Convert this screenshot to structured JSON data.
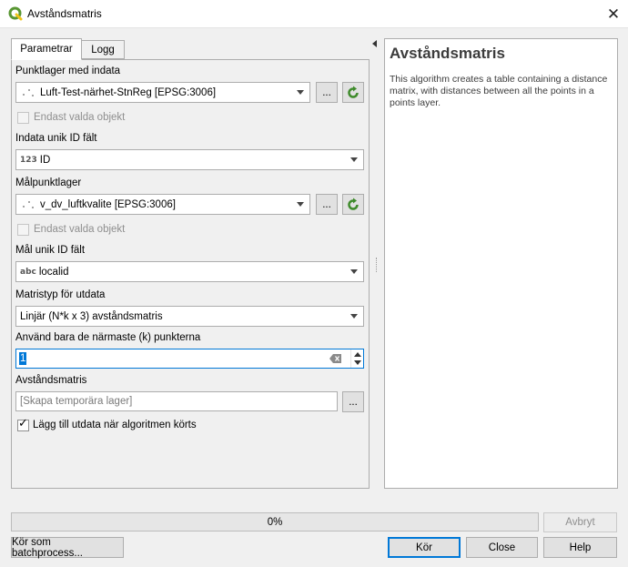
{
  "window": {
    "title": "Avståndsmatris",
    "close_symbol": "✕"
  },
  "tabs": {
    "parameters": "Parametrar",
    "log": "Logg"
  },
  "form": {
    "input_layer": {
      "label": "Punktlager med indata",
      "value": "Luft-Test-närhet-StnReg [EPSG:3006]",
      "iter_label": "...",
      "selected_only": "Endast valda objekt"
    },
    "input_id": {
      "label": "Indata unik ID fält",
      "type_tag": "123",
      "value": "ID"
    },
    "target_layer": {
      "label": "Målpunktlager",
      "value": "v_dv_luftkvalite [EPSG:3006]",
      "iter_label": "...",
      "selected_only": "Endast valda objekt"
    },
    "target_id": {
      "label": "Mål unik ID fält",
      "type_tag": "abc",
      "value": "localid"
    },
    "matrix_type": {
      "label": "Matristyp för utdata",
      "value": "Linjär (N*k x 3) avståndsmatris"
    },
    "nearest_k": {
      "label": "Använd bara de närmaste (k) punkterna",
      "value": "1"
    },
    "output": {
      "label": "Avståndsmatris",
      "placeholder": "[Skapa temporära lager]",
      "browse_label": "...",
      "add_output": "Lägg till utdata när algoritmen körts"
    }
  },
  "help": {
    "title": "Avståndsmatris",
    "text": "This algorithm creates a table containing a distance matrix, with distances between all the points in a points layer."
  },
  "progress": {
    "value_percent": 0,
    "label": "0%"
  },
  "buttons": {
    "cancel": "Avbryt",
    "batch": "Kör som batchprocess...",
    "run": "Kör",
    "close": "Close",
    "help": "Help"
  },
  "colors": {
    "accent": "#0078d7",
    "qgis_green": "#589632"
  }
}
